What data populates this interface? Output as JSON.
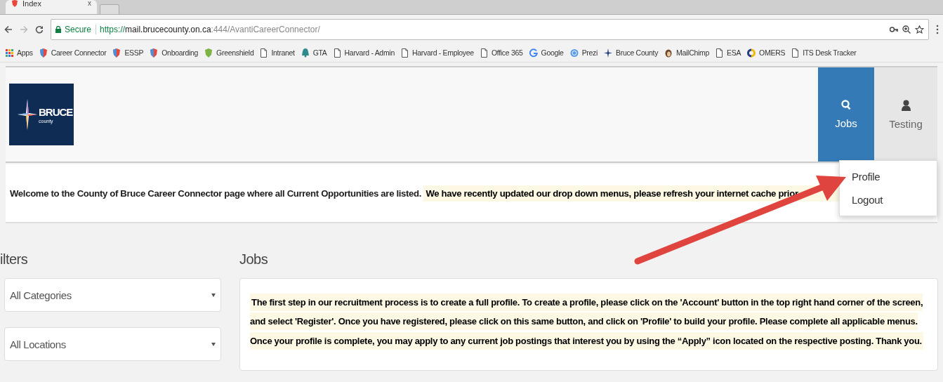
{
  "browser": {
    "tab": {
      "title": "Index",
      "close": "x"
    },
    "address_bar": {
      "secure_label": "Secure",
      "url_scheme": "https://",
      "url_host": "mail.brucecounty.on.ca",
      "url_rest": ":444/AvantiCareerConnector/"
    },
    "bookmarks": [
      {
        "kind": "apps",
        "label": "Apps"
      },
      {
        "kind": "shield",
        "label": "Career Connector"
      },
      {
        "kind": "shield",
        "label": "ESSP"
      },
      {
        "kind": "shield",
        "label": "Onboarding"
      },
      {
        "kind": "greenshield",
        "label": "Greenshield"
      },
      {
        "kind": "page",
        "label": "Intranet"
      },
      {
        "kind": "bell",
        "label": "GTA"
      },
      {
        "kind": "page",
        "label": "Harvard - Admin"
      },
      {
        "kind": "page",
        "label": "Harvard - Employee"
      },
      {
        "kind": "page",
        "label": "Office 365"
      },
      {
        "kind": "google",
        "label": "Google"
      },
      {
        "kind": "prezi",
        "label": "Prezi"
      },
      {
        "kind": "star",
        "label": "Bruce County"
      },
      {
        "kind": "chimp",
        "label": "MailChimp"
      },
      {
        "kind": "page",
        "label": "ESA"
      },
      {
        "kind": "ring",
        "label": "OMERS"
      },
      {
        "kind": "page",
        "label": "ITS Desk Tracker"
      }
    ]
  },
  "header": {
    "logo": {
      "name": "BRUCE",
      "sub": "county"
    },
    "nav": [
      {
        "kind": "search",
        "label": "Jobs",
        "selected": true
      },
      {
        "kind": "user",
        "label": "Testing",
        "selected": false
      }
    ],
    "user_menu": {
      "expanded": true,
      "items": [
        "Profile",
        "Logout"
      ]
    }
  },
  "welcome": {
    "text": "Welcome to the County of Bruce Career Connector page where all Current Opportunities are listed.",
    "notice": "We have recently updated our drop down menus, please refresh your internet cache prior"
  },
  "filters": {
    "heading": "ilters",
    "selects": [
      {
        "value": "All Categories"
      },
      {
        "value": "All Locations"
      }
    ]
  },
  "jobs": {
    "heading": "Jobs",
    "notice": "The first step in our recruitment process is to create a full profile. To create a profile, please click on the 'Account' button in the top right hand corner of the screen, and select 'Register'. Once you have registered, please click on this same button, and click on 'Profile' to build your profile. Please complete all applicable menus. Once your profile is complete, you may apply to any current job postings that interest you by using the “Apply” icon located on the respective posting. Thank you."
  }
}
